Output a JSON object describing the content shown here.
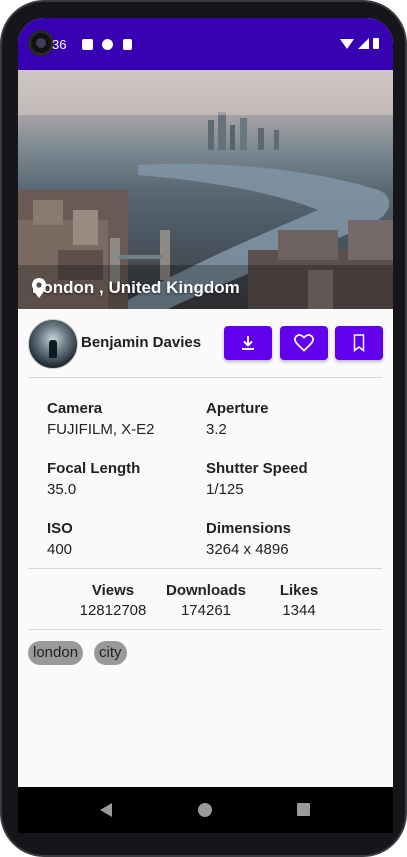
{
  "status_bar": {
    "time": "36",
    "bg_color": "#3700b3"
  },
  "photo": {
    "location": "London , United Kingdom",
    "author": "Benjamin Davies"
  },
  "actions": {
    "download_icon": "download-icon",
    "like_icon": "heart-icon",
    "bookmark_icon": "bookmark-icon",
    "accent_color": "#6200ee"
  },
  "specs": [
    {
      "label": "Camera",
      "value": "FUJIFILM, X-E2"
    },
    {
      "label": "Aperture",
      "value": "3.2"
    },
    {
      "label": "Focal Length",
      "value": "35.0"
    },
    {
      "label": "Shutter Speed",
      "value": "1/125"
    },
    {
      "label": "ISO",
      "value": "400"
    },
    {
      "label": "Dimensions",
      "value": "3264 x 4896"
    }
  ],
  "stats": [
    {
      "label": "Views",
      "value": "12812708"
    },
    {
      "label": "Downloads",
      "value": "174261"
    },
    {
      "label": "Likes",
      "value": "1344"
    }
  ],
  "tags": [
    "london",
    "city"
  ],
  "nav": {
    "back": "back-icon",
    "home": "home-icon",
    "recents": "recents-icon"
  }
}
